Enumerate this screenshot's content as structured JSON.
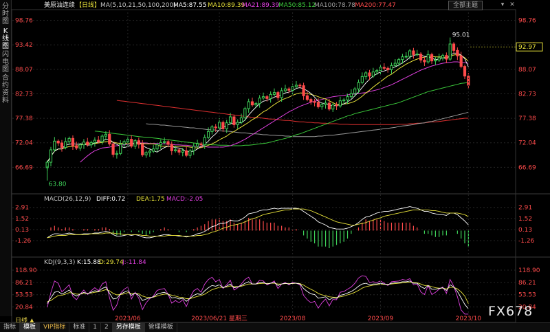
{
  "window": {
    "theme_button": "全部主题",
    "win_min": "▾",
    "win_close": "✕"
  },
  "sidebar": {
    "tabs": [
      {
        "label": "分时图",
        "active": false
      },
      {
        "label": "K线图",
        "active": true
      },
      {
        "label": "闪电图",
        "active": false
      },
      {
        "label": "合约资料",
        "active": false
      }
    ]
  },
  "header": {
    "symbol": "美原油连续",
    "period_tag": "【日线】",
    "ma_title": "MA(5,10,21,50,100,200)",
    "ma5": "MA5:87.55",
    "ma10": "MA10:89.39",
    "ma21": "MA21:89.39",
    "ma50": "MA50:85.12",
    "ma100": "MA100:78.78",
    "ma200": "MA200:77.47"
  },
  "colors": {
    "up": "#3fd45a",
    "down": "#ff4b4b",
    "ma5": "#ffffff",
    "ma10": "#e8e23a",
    "ma21": "#e040e0",
    "ma50": "#3ccd3c",
    "ma100": "#9a9a9a",
    "ma200": "#e03030",
    "price_tag": "#e8e23a",
    "axis_text": "#ff4b4b"
  },
  "chart_data": [
    {
      "type": "candlestick",
      "title": "美原油连续【日线】",
      "y_ticks": [
        98.76,
        93.42,
        88.07,
        82.73,
        77.38,
        72.04,
        66.69
      ],
      "y_tick_labels": [
        "98.76",
        "93.42",
        "88.07",
        "82.73",
        "77.38",
        "72.04",
        "66.69"
      ],
      "ylim": [
        61.5,
        100.5
      ],
      "last_price": 92.97,
      "last_price_label": "92.97",
      "annotations": [
        {
          "label": "95.01",
          "value": 95.01,
          "index": 110
        },
        {
          "label": "63.80",
          "value": 63.8,
          "index": 0
        }
      ],
      "x_labels": [
        {
          "label": "2023/06",
          "index": 22
        },
        {
          "label": "2023/06/21 星期三",
          "index": 47
        },
        {
          "label": "2023/08",
          "index": 67
        },
        {
          "label": "2023/09",
          "index": 91
        },
        {
          "label": "2023/10",
          "index": 115
        }
      ],
      "closes": [
        67.8,
        70.5,
        72.4,
        72.0,
        71.0,
        72.3,
        73.0,
        71.4,
        70.9,
        71.6,
        72.2,
        71.6,
        72.1,
        72.6,
        72.3,
        73.5,
        73.9,
        71.8,
        69.5,
        69.7,
        71.7,
        72.3,
        72.8,
        71.3,
        72.5,
        71.7,
        69.4,
        69.9,
        70.2,
        70.7,
        71.6,
        72.1,
        72.3,
        71.7,
        70.3,
        70.5,
        70.0,
        70.3,
        69.3,
        70.3,
        71.3,
        71.8,
        71.6,
        73.2,
        74.5,
        75.5,
        75.3,
        76.5,
        75.1,
        76.4,
        77.7,
        76.0,
        76.5,
        77.5,
        79.5,
        81.0,
        80.3,
        80.6,
        81.8,
        82.1,
        81.7,
        82.6,
        83.0,
        81.9,
        83.4,
        83.8,
        83.5,
        84.3,
        84.6,
        84.5,
        82.3,
        81.5,
        81.0,
        80.9,
        79.9,
        80.4,
        80.7,
        79.4,
        80.3,
        80.1,
        81.2,
        81.4,
        82.1,
        82.8,
        83.8,
        85.2,
        86.5,
        87.3,
        86.6,
        87.5,
        87.8,
        88.5,
        88.3,
        88.0,
        88.9,
        89.4,
        90.2,
        90.8,
        90.9,
        92.1,
        91.3,
        91.4,
        90.1,
        89.7,
        91.3,
        89.9,
        90.1,
        90.6,
        91.1,
        90.3,
        93.6,
        92.2,
        91.0,
        88.7,
        86.6,
        84.6
      ],
      "ma5": [
        67.8,
        69.1,
        70.2,
        70.7,
        70.7,
        71.6,
        71.7,
        71.9,
        71.7,
        71.8,
        71.8,
        71.5,
        71.6,
        72.0,
        72.2,
        72.4,
        72.8,
        72.8,
        72.1,
        71.7,
        71.3,
        71.0,
        71.2,
        71.6,
        72.1,
        72.1,
        71.5,
        71.0,
        70.7,
        70.3,
        70.0,
        70.5,
        71.0,
        71.3,
        71.2,
        71.0,
        70.9,
        70.6,
        70.1,
        70.1,
        70.2,
        70.7,
        71.2,
        71.7,
        72.4,
        73.3,
        74.0,
        74.9,
        75.4,
        75.8,
        76.2,
        76.3,
        76.4,
        76.4,
        77.0,
        78.1,
        79.0,
        79.8,
        80.6,
        81.1,
        81.3,
        81.6,
        82.0,
        82.3,
        82.5,
        82.9,
        83.1,
        83.4,
        83.9,
        84.1,
        83.8,
        83.4,
        82.8,
        82.0,
        81.1,
        80.7,
        80.6,
        80.3,
        80.1,
        80.2,
        80.3,
        80.5,
        81.0,
        81.5,
        82.3,
        83.1,
        84.1,
        85.1,
        85.9,
        86.6,
        87.1,
        87.5,
        87.7,
        88.0,
        88.3,
        88.6,
        89.0,
        89.5,
        90.0,
        90.7,
        91.1,
        91.3,
        91.2,
        90.9,
        90.8,
        90.5,
        90.2,
        90.3,
        90.6,
        90.4,
        91.1,
        91.6,
        91.6,
        91.2,
        90.4,
        88.6
      ],
      "ma10": [
        67.8,
        69.1,
        70.2,
        70.7,
        70.7,
        71.0,
        71.2,
        71.3,
        71.3,
        71.5,
        71.8,
        71.9,
        71.9,
        71.9,
        72.0,
        72.1,
        72.3,
        72.3,
        72.2,
        72.0,
        71.9,
        71.9,
        71.9,
        71.8,
        71.8,
        71.9,
        71.9,
        71.8,
        71.8,
        71.8,
        71.6,
        71.3,
        71.3,
        71.3,
        71.3,
        71.2,
        71.3,
        71.3,
        71.2,
        71.1,
        71.0,
        70.9,
        71.0,
        71.2,
        71.5,
        71.8,
        72.2,
        72.7,
        73.1,
        73.5,
        74.1,
        74.5,
        75.0,
        75.5,
        76.0,
        76.5,
        77.1,
        77.5,
        78.2,
        78.8,
        79.2,
        79.8,
        80.4,
        80.9,
        81.4,
        81.7,
        82.0,
        82.4,
        82.7,
        82.9,
        82.9,
        82.8,
        82.6,
        82.4,
        82.1,
        81.8,
        81.6,
        81.2,
        80.8,
        80.4,
        80.5,
        80.5,
        80.6,
        80.8,
        81.1,
        81.6,
        82.2,
        82.9,
        83.5,
        84.2,
        84.8,
        85.4,
        86.0,
        86.6,
        87.0,
        87.6,
        88.2,
        88.7,
        89.2,
        89.6,
        90.0,
        90.3,
        90.6,
        90.7,
        90.9,
        90.9,
        90.8,
        90.8,
        90.8,
        90.6,
        90.9,
        91.2,
        91.3,
        91.1,
        90.6,
        89.8
      ],
      "ma21": [
        67.8,
        68.5,
        69.2,
        69.8,
        70.3,
        70.6,
        70.9,
        71.0,
        71.1,
        71.3,
        71.4,
        71.5,
        71.6,
        71.7,
        71.8,
        71.9,
        72.0,
        72.0,
        72.0,
        71.9,
        71.9,
        71.9,
        71.9,
        71.8,
        71.8,
        71.7,
        71.6,
        71.6,
        71.5,
        71.5,
        71.4,
        71.3,
        71.3,
        71.2,
        71.2,
        71.1,
        71.1,
        71.1,
        71.1,
        71.1,
        71.2,
        71.4,
        71.7,
        72.0,
        72.4,
        72.8,
        73.3,
        73.8,
        74.3,
        74.8,
        75.3,
        75.8,
        76.3,
        76.8,
        77.3,
        77.8,
        78.3,
        78.8,
        79.2,
        79.6,
        80.0,
        80.3,
        80.6,
        80.9,
        81.1,
        81.3,
        81.5,
        81.7,
        81.9,
        82.1,
        82.2,
        82.3,
        82.4,
        82.5,
        82.6,
        82.7,
        82.8,
        82.9,
        83.0,
        83.2,
        83.4,
        83.6,
        83.8,
        84.1,
        84.4,
        84.7,
        85.1,
        85.5,
        85.9,
        86.3,
        86.7,
        87.1,
        87.5,
        87.9,
        88.2,
        88.5,
        88.8,
        89.0,
        89.2,
        89.4,
        89.5,
        89.6,
        89.7,
        89.7,
        89.6,
        89.5,
        89.4
      ],
      "ma50": [
        74.6,
        74.5,
        74.4,
        74.3,
        74.2,
        74.1,
        74.0,
        73.9,
        73.8,
        73.7,
        73.6,
        73.5,
        73.4,
        73.3,
        73.2,
        73.2,
        73.1,
        73.0,
        72.9,
        72.8,
        72.7,
        72.6,
        72.5,
        72.4,
        72.3,
        72.2,
        72.1,
        72.0,
        71.9,
        71.8,
        71.7,
        71.7,
        71.6,
        71.6,
        71.5,
        71.5,
        71.5,
        71.4,
        71.4,
        71.4,
        71.4,
        71.5,
        71.5,
        71.6,
        71.7,
        71.8,
        71.9,
        72.0,
        72.2,
        72.4,
        72.6,
        72.8,
        73.0,
        73.2,
        73.5,
        73.8,
        74.0,
        74.3,
        74.6,
        74.9,
        75.2,
        75.5,
        75.8,
        76.1,
        76.4,
        76.7,
        77.0,
        77.3,
        77.6,
        77.9,
        78.1,
        78.4,
        78.6,
        78.8,
        79.0,
        79.2,
        79.4,
        79.6,
        79.8,
        80.0,
        80.2,
        80.4,
        80.6,
        80.8,
        81.1,
        81.4,
        81.7,
        82.0,
        82.3,
        82.6,
        82.9,
        83.2,
        83.4,
        83.6,
        83.8,
        84.0,
        84.2,
        84.4,
        84.6,
        84.8,
        85.0,
        85.1,
        85.2
      ],
      "ma100": [
        76.2,
        76.1,
        76.1,
        76.0,
        75.9,
        75.9,
        75.8,
        75.7,
        75.6,
        75.6,
        75.5,
        75.4,
        75.3,
        75.3,
        75.2,
        75.1,
        75.0,
        74.9,
        74.9,
        74.8,
        74.7,
        74.6,
        74.6,
        74.5,
        74.4,
        74.3,
        74.2,
        74.2,
        74.1,
        74.0,
        74.0,
        73.9,
        73.8,
        73.8,
        73.7,
        73.7,
        73.6,
        73.6,
        73.5,
        73.5,
        73.4,
        73.4,
        73.4,
        73.4,
        73.4,
        73.4,
        73.4,
        73.5,
        73.5,
        73.6,
        73.7,
        73.7,
        73.8,
        73.9,
        74.0,
        74.1,
        74.2,
        74.3,
        74.4,
        74.5,
        74.6,
        74.7,
        74.8,
        74.9,
        75.0,
        75.1,
        75.2,
        75.3,
        75.4,
        75.6,
        75.7,
        75.8,
        75.9,
        76.0,
        76.2,
        76.3,
        76.4,
        76.6,
        76.7,
        76.9,
        77.1,
        77.3,
        77.5,
        77.7,
        77.9,
        78.1,
        78.3,
        78.5,
        78.7
      ],
      "ma200": [
        81.3,
        81.2,
        81.1,
        81.0,
        80.9,
        80.8,
        80.7,
        80.6,
        80.5,
        80.4,
        80.3,
        80.2,
        80.1,
        80.0,
        79.9,
        79.8,
        79.7,
        79.6,
        79.5,
        79.4,
        79.3,
        79.2,
        79.1,
        79.0,
        78.9,
        78.8,
        78.7,
        78.6,
        78.5,
        78.4,
        78.3,
        78.2,
        78.1,
        78.0,
        77.9,
        77.8,
        77.7,
        77.6,
        77.6,
        77.5,
        77.4,
        77.3,
        77.2,
        77.2,
        77.1,
        77.0,
        76.9,
        76.9,
        76.8,
        76.7,
        76.6,
        76.6,
        76.5,
        76.5,
        76.4,
        76.4,
        76.3,
        76.3,
        76.2,
        76.2,
        76.2,
        76.1,
        76.1,
        76.1,
        76.0,
        76.0,
        76.0,
        76.0,
        76.0,
        76.0,
        76.0,
        76.0,
        76.0,
        76.0,
        76.0,
        76.0,
        76.0,
        76.1,
        76.1,
        76.1,
        76.2,
        76.2,
        76.3,
        76.3,
        76.4,
        76.5,
        76.6,
        76.6,
        76.7,
        76.8,
        76.9,
        77.0,
        77.1,
        77.2,
        77.3,
        77.4,
        77.4
      ]
    },
    {
      "type": "line",
      "title": "MACD(26,12,9)",
      "diff_label": "DIFF:0.72",
      "dea_label": "DEA:1.75",
      "macd_label": "MACD:-2.05",
      "y_ticks": [
        2.91,
        1.52,
        0.13,
        -1.26
      ],
      "y_tick_labels": [
        "2.91",
        "1.52",
        "0.13",
        "-1.26"
      ],
      "ylim": [
        -2.8,
        3.4
      ],
      "diff": [
        -0.9,
        -0.6,
        -0.4,
        -0.4,
        -0.5,
        -0.4,
        -0.3,
        -0.4,
        -0.5,
        -0.5,
        -0.4,
        -0.4,
        -0.4,
        -0.3,
        -0.3,
        -0.2,
        -0.1,
        -0.2,
        -0.5,
        -0.7,
        -0.7,
        -0.6,
        -0.5,
        -0.6,
        -0.5,
        -0.6,
        -0.8,
        -0.9,
        -0.9,
        -0.8,
        -0.7,
        -0.6,
        -0.5,
        -0.5,
        -0.6,
        -0.6,
        -0.7,
        -0.7,
        -0.8,
        -0.7,
        -0.6,
        -0.4,
        -0.3,
        -0.1,
        0.2,
        0.5,
        0.6,
        0.9,
        0.9,
        1.0,
        1.3,
        1.2,
        1.2,
        1.4,
        1.7,
        2.1,
        2.2,
        2.3,
        2.5,
        2.6,
        2.6,
        2.7,
        2.8,
        2.7,
        2.8,
        2.8,
        2.8,
        2.8,
        2.8,
        2.7,
        2.4,
        2.1,
        1.8,
        1.5,
        1.1,
        0.9,
        0.7,
        0.4,
        0.3,
        0.2,
        0.2,
        0.2,
        0.3,
        0.5,
        0.7,
        1.0,
        1.4,
        1.7,
        1.8,
        2.0,
        2.2,
        2.3,
        2.4,
        2.4,
        2.5,
        2.6,
        2.7,
        2.8,
        2.9,
        3.0,
        2.9,
        2.8,
        2.6,
        2.4,
        2.4,
        2.2,
        2.1,
        2.0,
        2.0,
        1.9,
        2.2,
        2.2,
        2.0,
        1.6,
        1.2,
        0.72
      ],
      "dea": [
        -0.9,
        -0.8,
        -0.7,
        -0.6,
        -0.6,
        -0.6,
        -0.5,
        -0.5,
        -0.5,
        -0.5,
        -0.5,
        -0.5,
        -0.4,
        -0.4,
        -0.4,
        -0.4,
        -0.3,
        -0.3,
        -0.3,
        -0.4,
        -0.4,
        -0.5,
        -0.5,
        -0.5,
        -0.5,
        -0.5,
        -0.6,
        -0.6,
        -0.7,
        -0.7,
        -0.7,
        -0.7,
        -0.7,
        -0.6,
        -0.6,
        -0.6,
        -0.6,
        -0.7,
        -0.7,
        -0.7,
        -0.7,
        -0.6,
        -0.6,
        -0.5,
        -0.4,
        -0.2,
        -0.1,
        0.1,
        0.3,
        0.4,
        0.6,
        0.7,
        0.8,
        0.9,
        1.1,
        1.3,
        1.5,
        1.6,
        1.8,
        2.0,
        2.1,
        2.2,
        2.3,
        2.4,
        2.5,
        2.6,
        2.6,
        2.7,
        2.7,
        2.7,
        2.7,
        2.6,
        2.5,
        2.3,
        2.1,
        1.9,
        1.7,
        1.5,
        1.3,
        1.1,
        1.0,
        0.9,
        0.8,
        0.7,
        0.7,
        0.8,
        0.9,
        1.0,
        1.2,
        1.3,
        1.5,
        1.6,
        1.8,
        1.9,
        2.0,
        2.1,
        2.2,
        2.3,
        2.4,
        2.5,
        2.6,
        2.6,
        2.6,
        2.6,
        2.6,
        2.5,
        2.5,
        2.4,
        2.3,
        2.2,
        2.2,
        2.2,
        2.2,
        2.1,
        2.0,
        1.75
      ]
    },
    {
      "type": "line",
      "title": "KDJ(9,3,3)",
      "k_label": "K:15.88",
      "d_label": "D:29.74",
      "j_label": "J:-11.84",
      "y_ticks": [
        118.9,
        86.21,
        53.53,
        20.84
      ],
      "y_tick_labels": [
        "118.90",
        "86.21",
        "53.53",
        "20.84"
      ],
      "ylim": [
        0,
        128
      ],
      "k": [
        30,
        45,
        60,
        62,
        55,
        60,
        66,
        55,
        50,
        55,
        60,
        56,
        60,
        64,
        62,
        70,
        74,
        58,
        42,
        44,
        55,
        60,
        64,
        52,
        58,
        52,
        38,
        42,
        45,
        48,
        55,
        58,
        60,
        55,
        45,
        46,
        42,
        44,
        36,
        44,
        52,
        56,
        54,
        64,
        72,
        78,
        76,
        80,
        72,
        76,
        82,
        72,
        74,
        78,
        84,
        88,
        82,
        82,
        86,
        86,
        82,
        84,
        86,
        78,
        82,
        84,
        82,
        84,
        84,
        82,
        70,
        62,
        56,
        54,
        44,
        46,
        48,
        40,
        45,
        44,
        52,
        54,
        58,
        62,
        68,
        76,
        82,
        84,
        80,
        82,
        82,
        84,
        82,
        80,
        84,
        85,
        86,
        88,
        88,
        90,
        84,
        84,
        75,
        70,
        78,
        68,
        68,
        70,
        72,
        65,
        80,
        74,
        62,
        45,
        28,
        15.88
      ],
      "d": [
        35,
        38,
        45,
        51,
        52,
        55,
        59,
        58,
        55,
        55,
        57,
        57,
        58,
        60,
        61,
        64,
        67,
        64,
        57,
        53,
        54,
        56,
        59,
        57,
        57,
        56,
        50,
        47,
        46,
        47,
        50,
        53,
        55,
        55,
        52,
        50,
        47,
        46,
        43,
        43,
        46,
        49,
        51,
        55,
        61,
        67,
        70,
        73,
        73,
        74,
        77,
        75,
        75,
        76,
        79,
        82,
        82,
        82,
        83,
        84,
        83,
        84,
        84,
        82,
        82,
        83,
        83,
        83,
        84,
        83,
        79,
        73,
        68,
        63,
        57,
        53,
        51,
        48,
        47,
        46,
        48,
        50,
        53,
        56,
        60,
        65,
        71,
        75,
        77,
        79,
        80,
        81,
        81,
        81,
        82,
        83,
        84,
        85,
        86,
        87,
        86,
        85,
        82,
        78,
        78,
        75,
        72,
        71,
        71,
        69,
        73,
        73,
        69,
        61,
        50,
        29.74
      ]
    }
  ]
}
